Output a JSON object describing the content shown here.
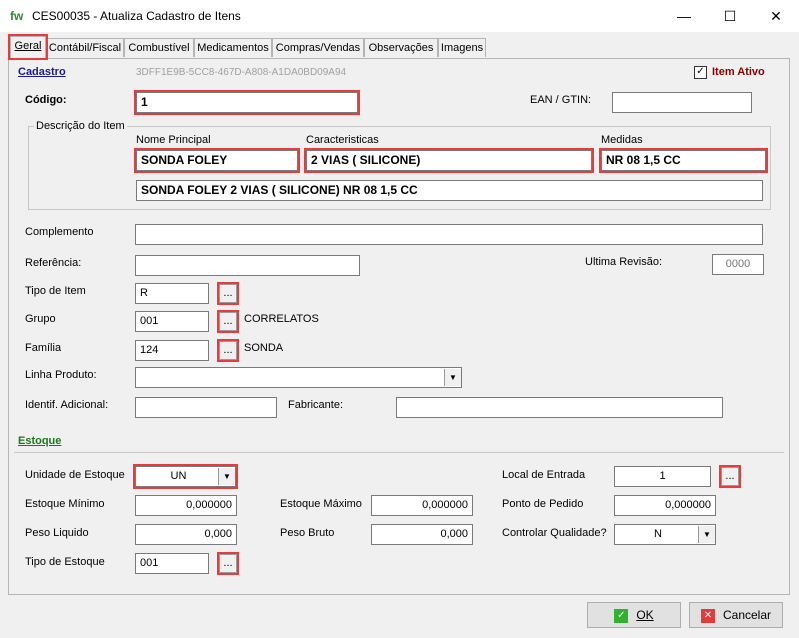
{
  "window": {
    "app_icon": "fw",
    "title": "CES00035 - Atualiza Cadastro de Itens",
    "minimize": "—",
    "maximize": "☐",
    "close": "✕"
  },
  "tabs": [
    "Geral",
    "Contábil/Fiscal",
    "Combustível",
    "Medicamentos",
    "Compras/Vendas",
    "Observações",
    "Imagens"
  ],
  "cadastro": {
    "section_label": "Cadastro",
    "guid": "3DFF1E9B-5CC8-467D-A808-A1DA0BD09A94",
    "item_ativo_label": "Item Ativo",
    "item_ativo_check": "✓",
    "codigo_label": "Código:",
    "codigo_value": "1",
    "ean_label": "EAN / GTIN:",
    "ean_value": "",
    "descricao_group_label": "Descrição do Item",
    "nome_principal_label": "Nome Principal",
    "nome_principal_value": "SONDA FOLEY",
    "caracteristicas_label": "Caracteristicas",
    "caracteristicas_value": "2 VIAS ( SILICONE)",
    "medidas_label": "Medidas",
    "medidas_value": "NR 08 1,5 CC",
    "descricao_completa": "SONDA FOLEY 2 VIAS ( SILICONE)  NR 08 1,5 CC",
    "complemento_label": "Complemento",
    "complemento_value": "",
    "referencia_label": "Referência:",
    "referencia_value": "",
    "ultima_revisao_label": "Ultima Revisão:",
    "ultima_revisao_value": "0000",
    "tipo_item_label": "Tipo de Item",
    "tipo_item_value": "R",
    "grupo_label": "Grupo",
    "grupo_value": "001",
    "grupo_desc": "CORRELATOS",
    "familia_label": "Família",
    "familia_value": "124",
    "familia_desc": "SONDA",
    "linha_produto_label": "Linha Produto:",
    "linha_produto_value": "",
    "identif_label": "Identif. Adicional:",
    "identif_value": "",
    "fabricante_label": "Fabricante:",
    "fabricante_value": "",
    "dots": "..."
  },
  "estoque": {
    "section_label": "Estoque",
    "unidade_label": "Unidade de Estoque",
    "unidade_value": "UN",
    "local_entrada_label": "Local de Entrada",
    "local_entrada_value": "1",
    "estoque_minimo_label": "Estoque Mínimo",
    "estoque_minimo_value": "0,000000",
    "estoque_maximo_label": "Estoque Máximo",
    "estoque_maximo_value": "0,000000",
    "ponto_pedido_label": "Ponto de Pedido",
    "ponto_pedido_value": "0,000000",
    "peso_liquido_label": "Peso Liquido",
    "peso_liquido_value": "0,000",
    "peso_bruto_label": "Peso Bruto",
    "peso_bruto_value": "0,000",
    "controlar_qualidade_label": "Controlar Qualidade?",
    "controlar_qualidade_value": "N",
    "tipo_estoque_label": "Tipo de Estoque",
    "tipo_estoque_value": "001"
  },
  "buttons": {
    "ok_label": "OK",
    "ok_icon": "✓",
    "cancel_label": "Cancelar",
    "cancel_icon": "✕"
  },
  "colors": {
    "highlight": "#e83b3b",
    "section_blue": "#1a1a8c",
    "section_green": "#1a7a1a",
    "ativo_red": "#8b0000"
  }
}
